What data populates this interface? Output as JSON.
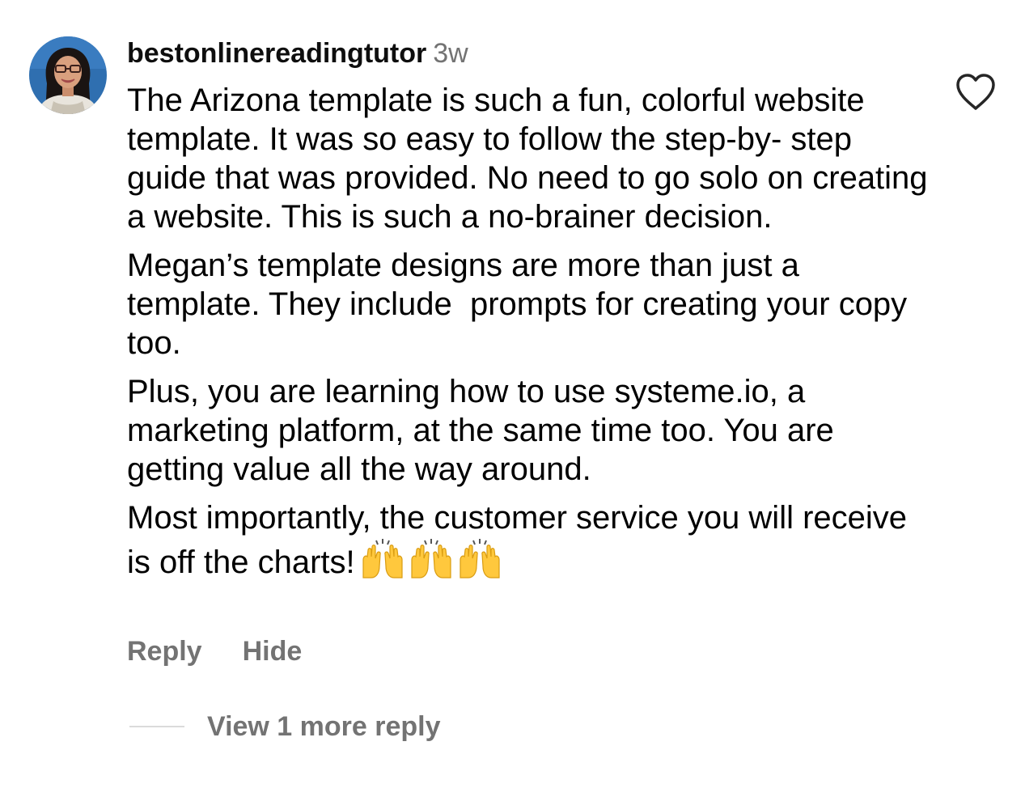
{
  "comment": {
    "username": "bestonlinereadingtutor",
    "timestamp": "3w",
    "avatar_icon": "profile-photo-avatar",
    "paragraphs": [
      "The Arizona template is such a fun, colorful website template. It was so easy to follow the step-by- step guide that was provided. No need to go solo on creating a website. This is such a no-brainer decision.",
      "Megan’s template designs are more than just a template. They include  prompts for creating your copy too.",
      "Plus, you are learning how to use systeme.io, a marketing platform, at the same time too. You are getting value all the way around.",
      "Most importantly, the customer service you will receive is off the charts!"
    ],
    "emojis": [
      "raising-hands",
      "raising-hands",
      "raising-hands"
    ],
    "like_icon": "heart-outline-icon"
  },
  "actions": {
    "reply_label": "Reply",
    "hide_label": "Hide"
  },
  "replies": {
    "view_label": "View 1 more reply"
  },
  "colors": {
    "text": "#000000",
    "secondary": "#737373",
    "divider": "#dbdbdb"
  }
}
